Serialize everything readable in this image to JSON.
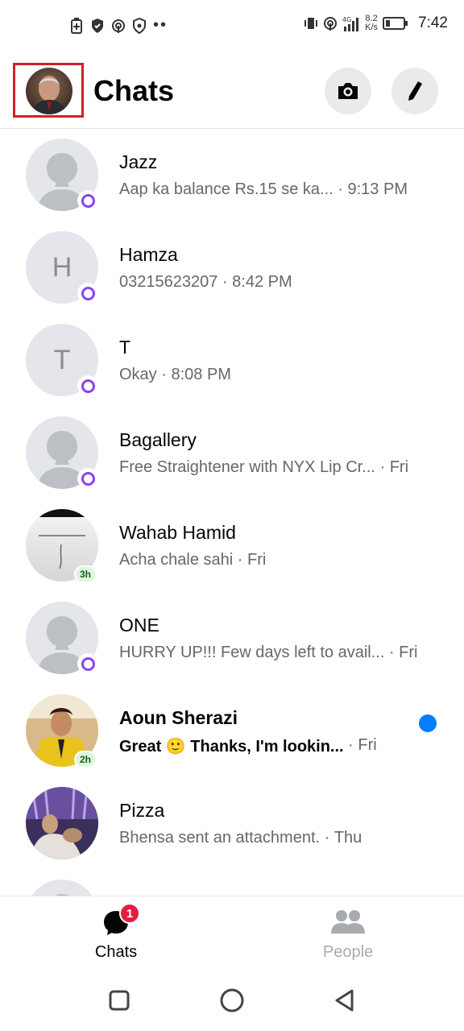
{
  "status_bar": {
    "time": "7:42",
    "speed_value": "8.2",
    "speed_unit": "K/s",
    "network": "4G"
  },
  "header": {
    "title": "Chats"
  },
  "chats": [
    {
      "name": "Jazz",
      "message": "Aap ka balance Rs.15 se ka...",
      "time": "9:13 PM",
      "avatar": "default",
      "badge": "messenger"
    },
    {
      "name": "Hamza",
      "message": "03215623207",
      "time": "8:42 PM",
      "avatar": "letter",
      "letter": "H",
      "badge": "messenger"
    },
    {
      "name": "T",
      "message": "Okay",
      "time": "8:08 PM",
      "avatar": "letter",
      "letter": "T",
      "badge": "messenger"
    },
    {
      "name": "Bagallery",
      "message": "Free Straightener with NYX Lip Cr...",
      "time": "Fri",
      "avatar": "default",
      "badge": "messenger"
    },
    {
      "name": "Wahab Hamid",
      "message": "Acha chale sahi",
      "time": "Fri",
      "avatar": "photo-quote",
      "badge": "active",
      "active_time": "3h"
    },
    {
      "name": "ONE",
      "message": "HURRY UP!!! Few days left to avail...",
      "time": "Fri",
      "avatar": "default",
      "badge": "messenger"
    },
    {
      "name": "Aoun Sherazi",
      "message": "Great 🙂  Thanks, I'm lookin...",
      "time": "Fri",
      "avatar": "photo-yellow",
      "badge": "active",
      "active_time": "2h",
      "unread": true
    },
    {
      "name": "Pizza",
      "message": "Bhensa sent an attachment.",
      "time": "Thu",
      "avatar": "photo-purple",
      "badge": "none"
    }
  ],
  "tabs": {
    "chats_label": "Chats",
    "chats_badge": "1",
    "people_label": "People"
  },
  "colors": {
    "messenger_purple": "#8b43f0",
    "unread_blue": "#0a7cff",
    "badge_red": "#e41e3f",
    "highlight_box": "#d21f2b"
  }
}
